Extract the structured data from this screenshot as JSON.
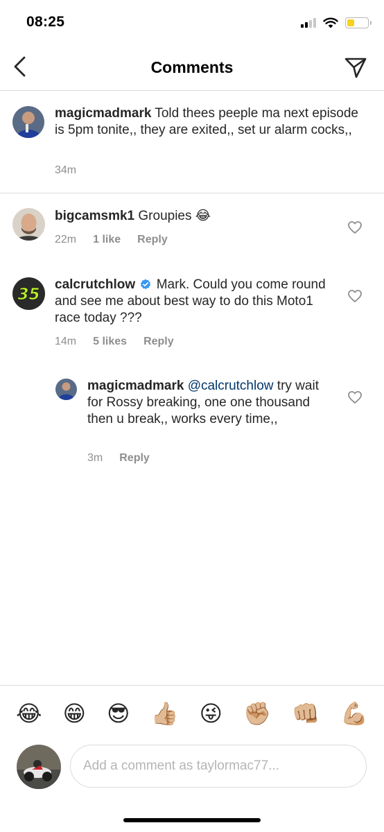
{
  "status_bar": {
    "time": "08:25",
    "signal_icon": "cellular-signal-icon",
    "wifi_icon": "wifi-icon",
    "battery_icon": "battery-icon",
    "battery_level": 0.35,
    "battery_color": "#f7d21e"
  },
  "header": {
    "title": "Comments",
    "back_icon": "chevron-left-icon",
    "share_icon": "paper-plane-icon"
  },
  "caption": {
    "username": "magicmadmark",
    "text": "Told thees peeple ma next episode is 5pm tonite,, they are exited,, set ur alarm cocks,,",
    "time": "34m"
  },
  "comments": [
    {
      "username": "bigcamsmk1",
      "text": "Groupies 😂",
      "time": "22m",
      "likes": "1 like",
      "reply": "Reply"
    },
    {
      "username": "calcrutchlow",
      "verified": true,
      "text": "Mark. Could you come round and see me about best way to do this Moto1 race today ???",
      "time": "14m",
      "likes": "5 likes",
      "reply": "Reply",
      "avatar_badge": "35"
    },
    {
      "username": "magicmadmark",
      "mention": "@calcrutchlow",
      "text": "try wait for Rossy breaking, one one thousand then u break,, works every time,,",
      "time": "3m",
      "reply": "Reply"
    }
  ],
  "emoji_bar": [
    "😂",
    "😁",
    "😎",
    "👍🏼",
    "😜",
    "✊🏼",
    "👊🏼",
    "💪🏼"
  ],
  "input": {
    "placeholder": "Add a comment as taylormac77..."
  },
  "colors": {
    "text": "#262626",
    "secondary": "#8e8e8e",
    "divider": "#dbdbdb",
    "verified_blue": "#3897f0",
    "mention": "#00376b"
  }
}
